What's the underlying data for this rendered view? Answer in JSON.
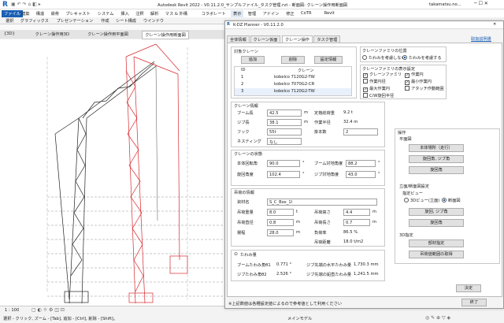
{
  "revit": {
    "title": "Autodesk Revit 2022 - V0.11.2.0_サンプルファイル_タスク管理.rvt - 断面図: クレーン操作用断面図",
    "user": "takamatsu.no...",
    "file_tab": "ファイル",
    "ribbon_tabs": [
      "建築",
      "構造",
      "鉄骨",
      "プレキャスト",
      "システム",
      "挿入",
      "注釈",
      "解析",
      "マス & 外構",
      "コラボレート",
      "表示",
      "管理",
      "アドイン",
      "修正",
      "CoTR",
      "Revit"
    ],
    "ribbon_row": [
      "選択",
      "グラフィックス",
      "プレゼンテーション",
      "作成",
      "シート構成",
      "ウインドウ"
    ],
    "view_tabs": [
      "{3D}",
      "クレーン操作用3D",
      "クレーン操作用平面図",
      "クレーン操作用断面図"
    ],
    "scale": "1 : 100",
    "status": "選択 - クリック, ズーム - [Tab], 追加 - [Ctrl], 削除 - [Shift]。",
    "status_right": "メインモデル"
  },
  "dialog": {
    "title": "K-DZ Planner - V0.11.2.0",
    "help": "取扱説明書",
    "tabs": [
      "全体情報",
      "クレーン仮面",
      "クレーン操作",
      "タスク管理"
    ],
    "crane_sel": {
      "title": "対象クレーン",
      "add": "追加",
      "delete": "削除",
      "settings": "設定情報",
      "col_id": "ID",
      "col_crane": "クレーン",
      "rows": [
        {
          "id": "1",
          "name": "kobelco 7120G2-TW"
        },
        {
          "id": "2",
          "name": "kobelco 7070G2-CR"
        },
        {
          "id": "3",
          "name": "kobelco 7120G2-TW"
        }
      ]
    },
    "family_loc": {
      "title": "クレーンファミリの位置",
      "opt1": "たわみを考慮しない",
      "opt2": "たわみを考慮する"
    },
    "family_disp": {
      "title": "クレーンファミリの表示設定",
      "items": [
        {
          "label": "クレーンファミリ",
          "checked": true
        },
        {
          "label": "作業円",
          "checked": true
        },
        {
          "label": "作業円径",
          "checked": false
        },
        {
          "label": "最小作業円",
          "checked": true
        },
        {
          "label": "最大作業円",
          "checked": true
        },
        {
          "label": "アタッチ作動範囲",
          "checked": false
        },
        {
          "label": "C/W旋回半径",
          "checked": false
        }
      ]
    },
    "crane_info": {
      "title": "クレーン情報",
      "boom_label": "ブーム長",
      "boom": "42.5",
      "jib_label": "ジブ長",
      "jib": "38.1",
      "hook_label": "フック",
      "hook": "55t",
      "nesting_label": "ネスティング",
      "nesting": "なし",
      "rated_load_label": "定格総荷重",
      "rated_load": "9.2 t",
      "radius_label": "作業半径",
      "radius": "32.4 m",
      "parts_label": "掛本数",
      "parts": "2",
      "unit_m": "m"
    },
    "state": {
      "title": "クレーンの状態",
      "swing_label": "本体回転角",
      "swing": "90.0",
      "rot_label": "旋回角度",
      "rot": "102.4",
      "boom_angle_label": "ブーム対地角度",
      "boom_angle": "88.2",
      "jib_angle_label": "ジブ対地角度",
      "jib_angle": "43.0",
      "unit_deg": "°"
    },
    "load": {
      "title": "吊荷の情報",
      "name_label": "資材名",
      "name": "S_C_Box_1l",
      "w_label": "吊荷重量",
      "w": "8.0",
      "wu": "t",
      "d_label": "吊荷直径",
      "d": "0.8",
      "du": "m",
      "pos_label": "揚程",
      "pos": "28.0",
      "posu": "m",
      "l_label": "吊荷高さ",
      "l": "4.4",
      "lu": "m",
      "h_label": "吊荷長さ",
      "h": "0.7",
      "hu": "m",
      "rate_label": "負荷率",
      "rate": "86.5 %",
      "dist_label": "吊荷距離",
      "dist": "18.0 t/m2"
    },
    "deflection": {
      "title": "たわみ量",
      "boom_label": "ブームたわみ角θ1",
      "boom": "0.771 °",
      "jib_label": "ジブたわみ角θ2",
      "jib": "2.526 °",
      "jib_tip_label": "ジブ先端の水平たわみ量",
      "jib_tip": "1,730.3 mm",
      "jib_rot_label": "ジブ先端の鉛直たわみ量",
      "jib_rot": "1,241.5 mm"
    },
    "ops": {
      "title": "操作",
      "plan_title": "平面図",
      "b1": "本体場所（走行）",
      "b2": "旋回角, ジブ角",
      "b3": "旋回角",
      "sec_title": "立面/断面図設定",
      "sec_view": "指定ビュー",
      "o1": "3Dビュー(立面)",
      "o2": "断面図",
      "b4": "旋回, ジブ角",
      "b5": "旋回角",
      "t3d": "3D指定",
      "b6": "部材指定",
      "b7": "吊荷値範囲の取得"
    },
    "apply": "決定",
    "note": "※上記数値は各種設定値によるので参考値として利用ください",
    "close": "終了"
  }
}
